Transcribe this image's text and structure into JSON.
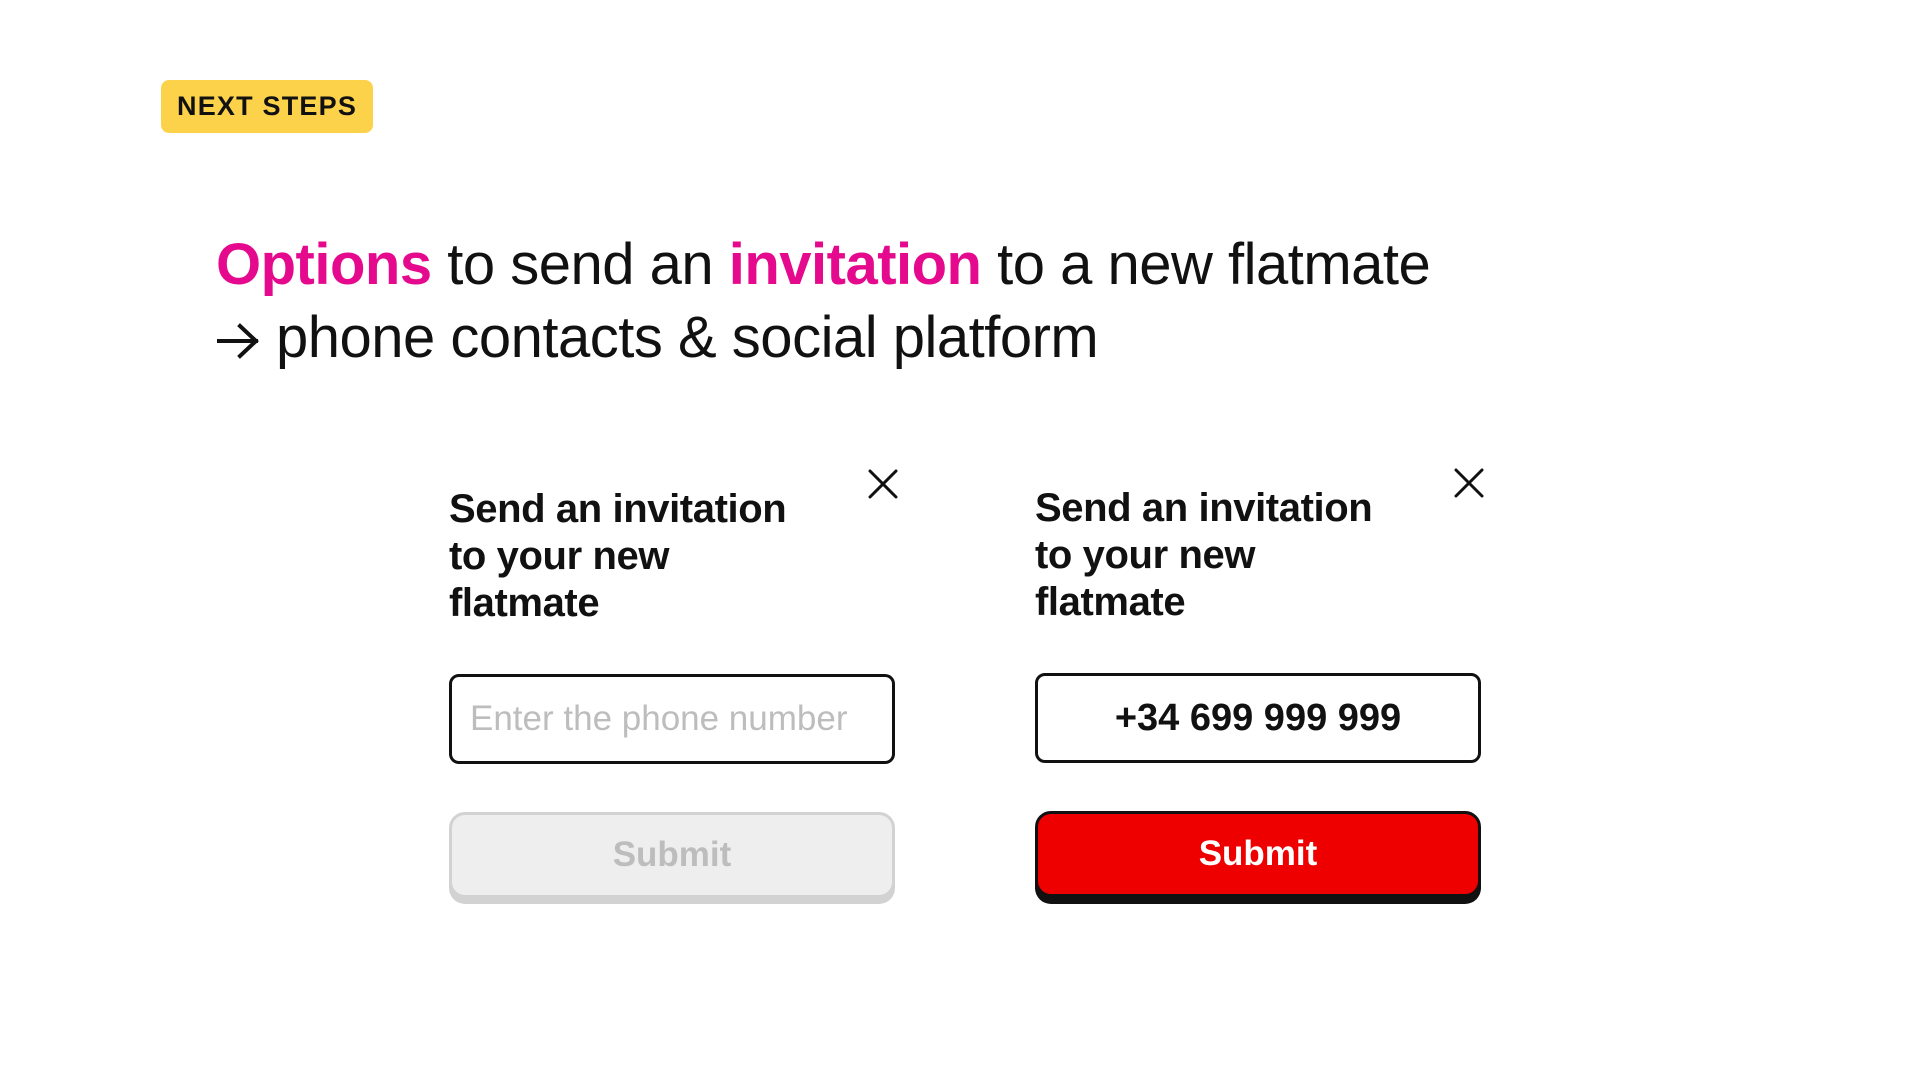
{
  "tag": {
    "label": "NEXT STEPS",
    "color": "#FDD24B"
  },
  "headline": {
    "line1": {
      "hl1": "Options",
      "text1": " to send an ",
      "hl2": "invitation",
      "text2": " to a new flatmate"
    },
    "line2": {
      "arrow_icon": "arrow-right-icon",
      "text": "phone contacts & social platform"
    },
    "highlight_color": "#E5098E"
  },
  "cards": {
    "empty": {
      "title": "Send an invitation to your new flatmate",
      "close_icon": "close-icon",
      "input_placeholder": "Enter the phone number",
      "input_value": "",
      "submit_label": "Submit",
      "submit_state": "disabled"
    },
    "filled": {
      "title": "Send an invitation to your new flatmate",
      "close_icon": "close-icon",
      "input_value": "+34 699 999 999",
      "submit_label": "Submit",
      "submit_state": "active",
      "submit_color": "#EE0000"
    }
  }
}
